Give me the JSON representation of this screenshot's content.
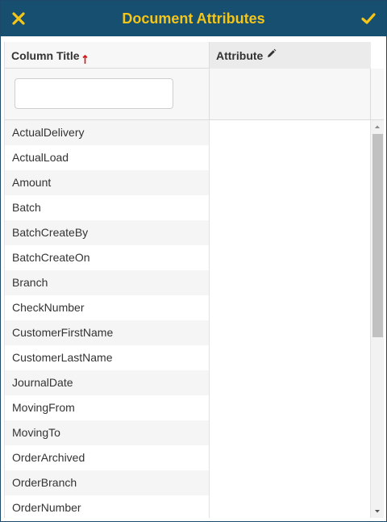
{
  "dialog": {
    "title": "Document Attributes",
    "close_icon": "close-x-icon",
    "confirm_icon": "checkmark-icon",
    "accent_color": "#f5c518",
    "header_color": "#164f70"
  },
  "grid": {
    "columns": [
      {
        "title": "Column Title",
        "icon": "sort-ascending-icon"
      },
      {
        "title": "Attribute",
        "icon": "pencil-edit-icon"
      }
    ],
    "filter": {
      "value": "",
      "placeholder": ""
    },
    "rows": [
      {
        "title": "ActualDelivery",
        "attribute": ""
      },
      {
        "title": "ActualLoad",
        "attribute": ""
      },
      {
        "title": "Amount",
        "attribute": ""
      },
      {
        "title": "Batch",
        "attribute": ""
      },
      {
        "title": "BatchCreateBy",
        "attribute": ""
      },
      {
        "title": "BatchCreateOn",
        "attribute": ""
      },
      {
        "title": "Branch",
        "attribute": ""
      },
      {
        "title": "CheckNumber",
        "attribute": ""
      },
      {
        "title": "CustomerFirstName",
        "attribute": ""
      },
      {
        "title": "CustomerLastName",
        "attribute": ""
      },
      {
        "title": "JournalDate",
        "attribute": ""
      },
      {
        "title": "MovingFrom",
        "attribute": ""
      },
      {
        "title": "MovingTo",
        "attribute": ""
      },
      {
        "title": "OrderArchived",
        "attribute": ""
      },
      {
        "title": "OrderBranch",
        "attribute": ""
      },
      {
        "title": "OrderNumber",
        "attribute": ""
      }
    ]
  }
}
